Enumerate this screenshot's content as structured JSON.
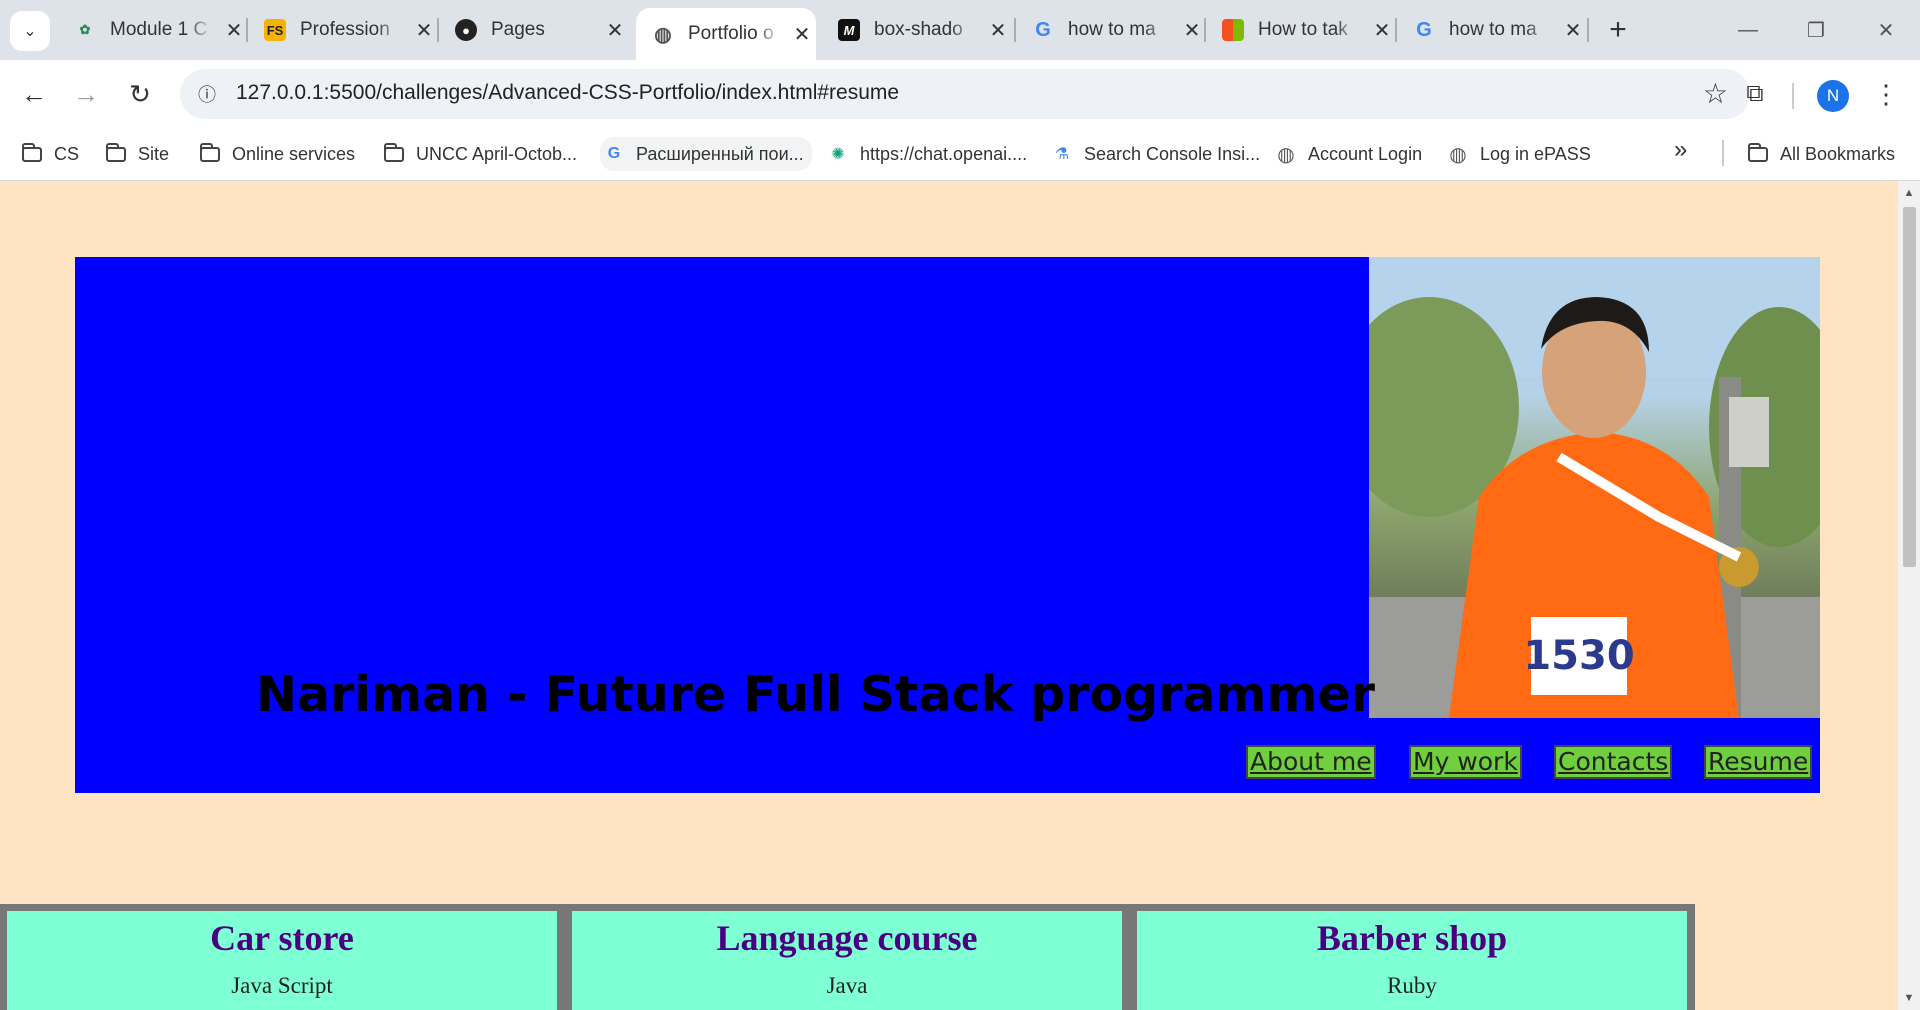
{
  "tabs": [
    {
      "title": "Module 1 C",
      "icon": "fern-icon",
      "active": false
    },
    {
      "title": "Profession",
      "icon": "fs-icon",
      "active": false
    },
    {
      "title": "Pages",
      "icon": "github-icon",
      "active": false
    },
    {
      "title": "Portfolio o",
      "icon": "globe-icon",
      "active": true
    },
    {
      "title": "box-shado",
      "icon": "mdn-icon",
      "active": false
    },
    {
      "title": "how to ma",
      "icon": "google-icon",
      "active": false
    },
    {
      "title": "How to tak",
      "icon": "microsoft-icon",
      "active": false
    },
    {
      "title": "how to ma",
      "icon": "google-icon",
      "active": false
    }
  ],
  "address": {
    "url": "127.0.0.1:5500/challenges/Advanced-CSS-Portfolio/index.html#resume"
  },
  "profile": {
    "initial": "N"
  },
  "bookmarks": [
    {
      "label": "CS",
      "icon": "folder-icon"
    },
    {
      "label": "Site",
      "icon": "folder-icon"
    },
    {
      "label": "Online services",
      "icon": "folder-icon"
    },
    {
      "label": "UNCC April-Octob...",
      "icon": "folder-icon"
    },
    {
      "label": "Расширенный пои...",
      "icon": "google-icon"
    },
    {
      "label": "https://chat.openai....",
      "icon": "openai-icon"
    },
    {
      "label": "Search Console Insi...",
      "icon": "search-console-icon"
    },
    {
      "label": "Account Login",
      "icon": "globe-icon"
    },
    {
      "label": "Log in ePASS",
      "icon": "globe-icon"
    }
  ],
  "all_bookmarks": "All Bookmarks",
  "page": {
    "header_title": "Nariman - Future Full Stack programmer",
    "nav": [
      "About me",
      "My work",
      "Contacts",
      "Resume"
    ],
    "cards": [
      {
        "title": "Car store",
        "tech": "Java Script"
      },
      {
        "title": "Language course",
        "tech": "Java"
      },
      {
        "title": "Barber shop",
        "tech": "Ruby"
      }
    ]
  },
  "colors": {
    "page_bg": "#ffe4c4",
    "hero_bg": "#0000ff",
    "nav_bg": "#6fcf3d",
    "card_bg": "#7fffd4",
    "card_title": "#4b0082"
  }
}
